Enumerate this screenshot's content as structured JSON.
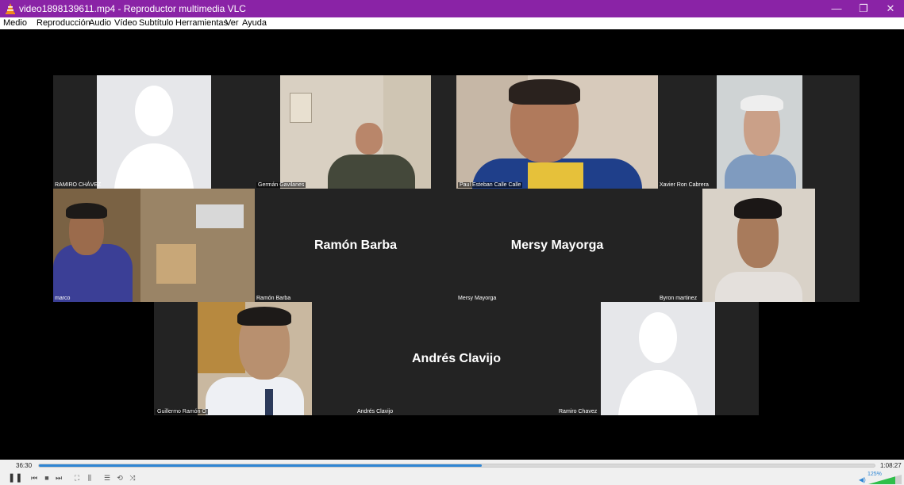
{
  "window": {
    "title": "video1898139611.mp4 - Reproductor multimedia VLC",
    "minimize_glyph": "—",
    "maximize_glyph": "❐",
    "close_glyph": "✕"
  },
  "menu": [
    "Medio",
    "Reproducción",
    "Audio",
    "Vídeo",
    "Subtítulo",
    "Herramientas",
    "Ver",
    "Ayuda"
  ],
  "participants": {
    "ramiro_chavez_top": "RAMIRO CHÁVEZ",
    "german": "Germán Gavilanes",
    "paul": "Paul Esteban Calle Calle",
    "xavier": "Xavier Ron Cabrera",
    "marco": "marco",
    "ramon_label": "Ramón Barba",
    "ramon_big": "Ramón Barba",
    "mersy_label": "Mersy Mayorga",
    "mersy_big": "Mersy Mayorga",
    "byron": "Byron martinez",
    "guillermo": "Guillermo Ramón O",
    "andres_label": "Andrés Clavijo",
    "andres_big": "Andrés Clavijo",
    "ramiro_bottom": "Ramiro Chavez"
  },
  "controls": {
    "elapsed": "36:30",
    "total": "1:08:27",
    "progress_fraction": 0.53,
    "volume": "125%",
    "icons": [
      "pause-icon",
      "previous-icon",
      "stop-icon",
      "next-icon",
      "fullscreen-icon",
      "extended-settings-icon",
      "playlist-icon",
      "loop-icon",
      "shuffle-icon",
      "volume-icon"
    ]
  },
  "colors": {
    "titlebar": "#8a23a6",
    "accent": "#2f86d4",
    "tile_bg": "#232323"
  }
}
